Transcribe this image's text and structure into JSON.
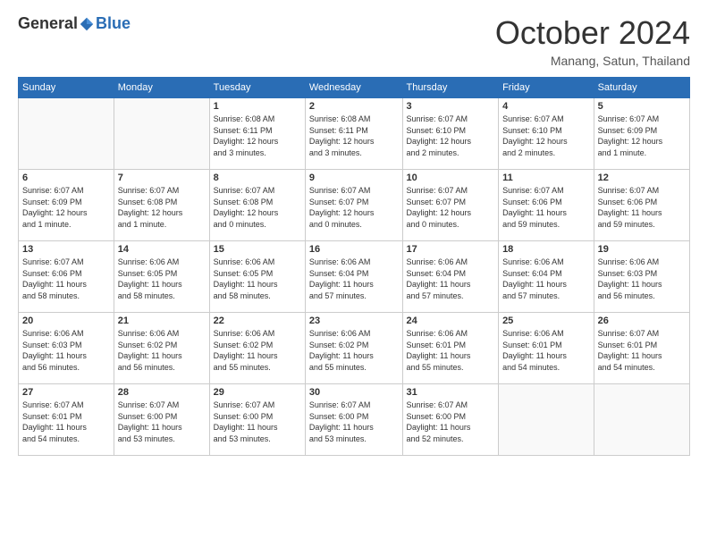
{
  "header": {
    "logo_general": "General",
    "logo_blue": "Blue",
    "month": "October 2024",
    "location": "Manang, Satun, Thailand"
  },
  "weekdays": [
    "Sunday",
    "Monday",
    "Tuesday",
    "Wednesday",
    "Thursday",
    "Friday",
    "Saturday"
  ],
  "weeks": [
    [
      {
        "day": "",
        "info": ""
      },
      {
        "day": "",
        "info": ""
      },
      {
        "day": "1",
        "info": "Sunrise: 6:08 AM\nSunset: 6:11 PM\nDaylight: 12 hours\nand 3 minutes."
      },
      {
        "day": "2",
        "info": "Sunrise: 6:08 AM\nSunset: 6:11 PM\nDaylight: 12 hours\nand 3 minutes."
      },
      {
        "day": "3",
        "info": "Sunrise: 6:07 AM\nSunset: 6:10 PM\nDaylight: 12 hours\nand 2 minutes."
      },
      {
        "day": "4",
        "info": "Sunrise: 6:07 AM\nSunset: 6:10 PM\nDaylight: 12 hours\nand 2 minutes."
      },
      {
        "day": "5",
        "info": "Sunrise: 6:07 AM\nSunset: 6:09 PM\nDaylight: 12 hours\nand 1 minute."
      }
    ],
    [
      {
        "day": "6",
        "info": "Sunrise: 6:07 AM\nSunset: 6:09 PM\nDaylight: 12 hours\nand 1 minute."
      },
      {
        "day": "7",
        "info": "Sunrise: 6:07 AM\nSunset: 6:08 PM\nDaylight: 12 hours\nand 1 minute."
      },
      {
        "day": "8",
        "info": "Sunrise: 6:07 AM\nSunset: 6:08 PM\nDaylight: 12 hours\nand 0 minutes."
      },
      {
        "day": "9",
        "info": "Sunrise: 6:07 AM\nSunset: 6:07 PM\nDaylight: 12 hours\nand 0 minutes."
      },
      {
        "day": "10",
        "info": "Sunrise: 6:07 AM\nSunset: 6:07 PM\nDaylight: 12 hours\nand 0 minutes."
      },
      {
        "day": "11",
        "info": "Sunrise: 6:07 AM\nSunset: 6:06 PM\nDaylight: 11 hours\nand 59 minutes."
      },
      {
        "day": "12",
        "info": "Sunrise: 6:07 AM\nSunset: 6:06 PM\nDaylight: 11 hours\nand 59 minutes."
      }
    ],
    [
      {
        "day": "13",
        "info": "Sunrise: 6:07 AM\nSunset: 6:06 PM\nDaylight: 11 hours\nand 58 minutes."
      },
      {
        "day": "14",
        "info": "Sunrise: 6:06 AM\nSunset: 6:05 PM\nDaylight: 11 hours\nand 58 minutes."
      },
      {
        "day": "15",
        "info": "Sunrise: 6:06 AM\nSunset: 6:05 PM\nDaylight: 11 hours\nand 58 minutes."
      },
      {
        "day": "16",
        "info": "Sunrise: 6:06 AM\nSunset: 6:04 PM\nDaylight: 11 hours\nand 57 minutes."
      },
      {
        "day": "17",
        "info": "Sunrise: 6:06 AM\nSunset: 6:04 PM\nDaylight: 11 hours\nand 57 minutes."
      },
      {
        "day": "18",
        "info": "Sunrise: 6:06 AM\nSunset: 6:04 PM\nDaylight: 11 hours\nand 57 minutes."
      },
      {
        "day": "19",
        "info": "Sunrise: 6:06 AM\nSunset: 6:03 PM\nDaylight: 11 hours\nand 56 minutes."
      }
    ],
    [
      {
        "day": "20",
        "info": "Sunrise: 6:06 AM\nSunset: 6:03 PM\nDaylight: 11 hours\nand 56 minutes."
      },
      {
        "day": "21",
        "info": "Sunrise: 6:06 AM\nSunset: 6:02 PM\nDaylight: 11 hours\nand 56 minutes."
      },
      {
        "day": "22",
        "info": "Sunrise: 6:06 AM\nSunset: 6:02 PM\nDaylight: 11 hours\nand 55 minutes."
      },
      {
        "day": "23",
        "info": "Sunrise: 6:06 AM\nSunset: 6:02 PM\nDaylight: 11 hours\nand 55 minutes."
      },
      {
        "day": "24",
        "info": "Sunrise: 6:06 AM\nSunset: 6:01 PM\nDaylight: 11 hours\nand 55 minutes."
      },
      {
        "day": "25",
        "info": "Sunrise: 6:06 AM\nSunset: 6:01 PM\nDaylight: 11 hours\nand 54 minutes."
      },
      {
        "day": "26",
        "info": "Sunrise: 6:07 AM\nSunset: 6:01 PM\nDaylight: 11 hours\nand 54 minutes."
      }
    ],
    [
      {
        "day": "27",
        "info": "Sunrise: 6:07 AM\nSunset: 6:01 PM\nDaylight: 11 hours\nand 54 minutes."
      },
      {
        "day": "28",
        "info": "Sunrise: 6:07 AM\nSunset: 6:00 PM\nDaylight: 11 hours\nand 53 minutes."
      },
      {
        "day": "29",
        "info": "Sunrise: 6:07 AM\nSunset: 6:00 PM\nDaylight: 11 hours\nand 53 minutes."
      },
      {
        "day": "30",
        "info": "Sunrise: 6:07 AM\nSunset: 6:00 PM\nDaylight: 11 hours\nand 53 minutes."
      },
      {
        "day": "31",
        "info": "Sunrise: 6:07 AM\nSunset: 6:00 PM\nDaylight: 11 hours\nand 52 minutes."
      },
      {
        "day": "",
        "info": ""
      },
      {
        "day": "",
        "info": ""
      }
    ]
  ]
}
